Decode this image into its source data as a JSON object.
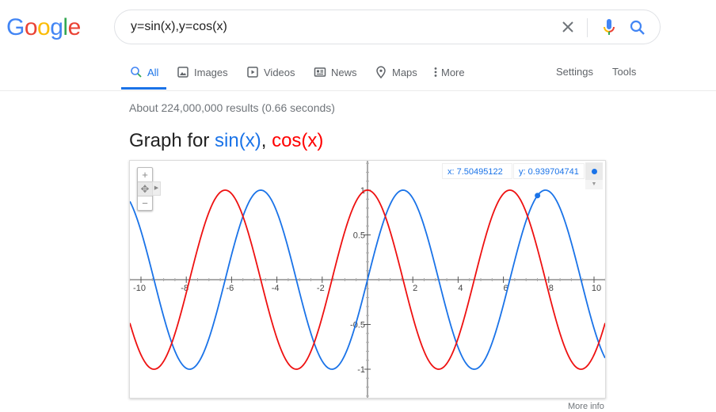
{
  "logo": {
    "letters": [
      "G",
      "o",
      "o",
      "g",
      "l",
      "e"
    ],
    "colors": [
      "#4285f4",
      "#ea4335",
      "#fbbc05",
      "#4285f4",
      "#34a853",
      "#ea4335"
    ]
  },
  "search": {
    "query": "y=sin(x),y=cos(x)",
    "clear_icon": "close-icon",
    "mic_icon": "microphone-icon",
    "search_icon": "search-icon"
  },
  "tabs": [
    {
      "label": "All",
      "icon": "search-icon",
      "active": true
    },
    {
      "label": "Images",
      "icon": "image-icon"
    },
    {
      "label": "Videos",
      "icon": "play-icon"
    },
    {
      "label": "News",
      "icon": "newspaper-icon"
    },
    {
      "label": "Maps",
      "icon": "map-pin-icon"
    },
    {
      "label": "More",
      "icon": "more-vert-icon"
    }
  ],
  "tools": {
    "settings": "Settings",
    "tools": "Tools"
  },
  "stats": "About 224,000,000 results (0.66 seconds)",
  "graph_title": {
    "prefix": "Graph for ",
    "f1": "sin(x)",
    "sep": ", ",
    "f2": "cos(x)"
  },
  "graph": {
    "controls": {
      "zoom_in": "+",
      "pan": "✥",
      "zoom_out": "−"
    },
    "readout": {
      "x": "x: 7.50495122",
      "y": "y: 0.939704741"
    },
    "more_info": "More info"
  },
  "chart_data": {
    "type": "line",
    "title": "Graph for sin(x), cos(x)",
    "xlim": [
      -10.5,
      10.5
    ],
    "ylim": [
      -1.3,
      1.3
    ],
    "x_ticks": [
      -10,
      -8,
      -6,
      -4,
      -2,
      2,
      4,
      6,
      8,
      10
    ],
    "y_ticks": [
      1,
      0.5,
      -0.5,
      -1
    ],
    "series": [
      {
        "name": "sin(x)",
        "fn": "sin",
        "color": "#1a73e8"
      },
      {
        "name": "cos(x)",
        "fn": "cos",
        "color": "#ee1111"
      }
    ],
    "highlight_point": {
      "series": "sin(x)",
      "x": 7.50495122,
      "y": 0.939704741
    }
  }
}
